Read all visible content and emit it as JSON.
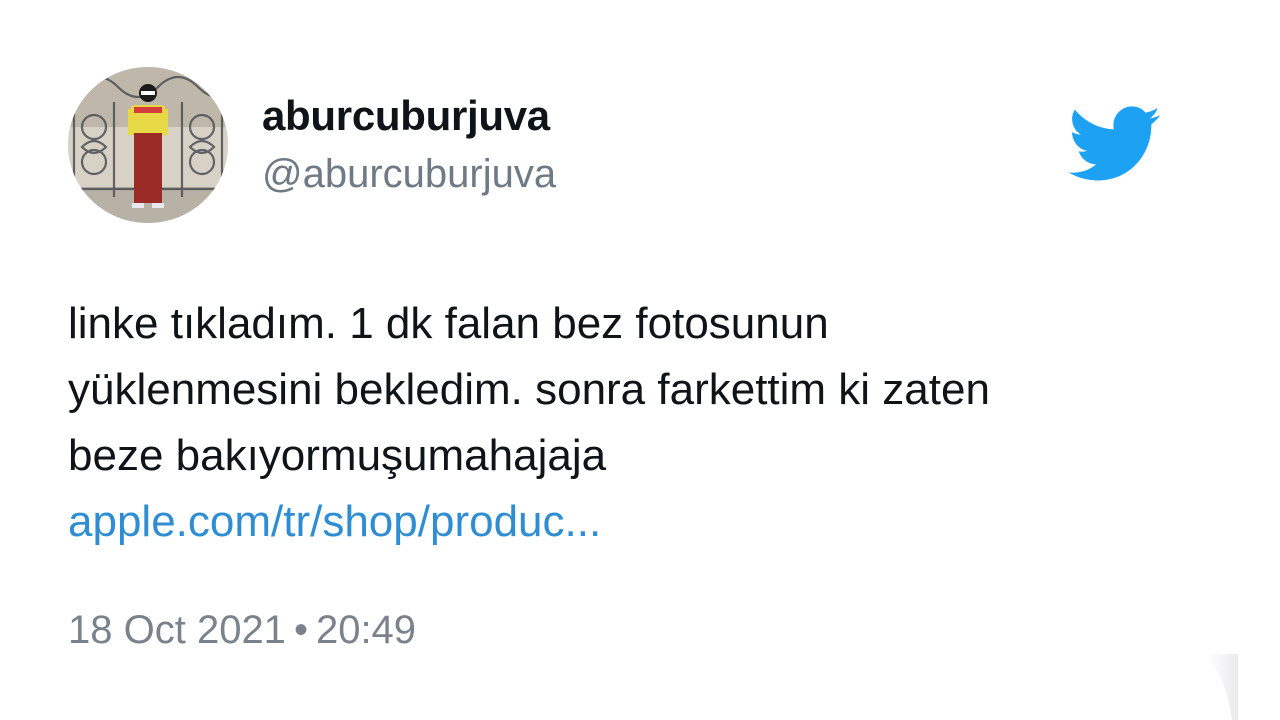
{
  "user": {
    "display_name": "aburcuburjuva",
    "handle": "@aburcuburjuva",
    "avatar_icon": "profile-photo"
  },
  "brand": {
    "icon": "twitter-bird-icon",
    "color": "#1da1f2"
  },
  "tweet": {
    "lines": [
      "linke tıkladım. 1 dk falan bez fotosunun",
      "yüklenmesini bekledim. sonra farkettim ki zaten",
      "beze bakıyormuşumahajaja"
    ],
    "link": "apple.com/tr/shop/produc..."
  },
  "meta": {
    "date": "18 Oct 2021",
    "separator": "•",
    "time": "20:49"
  },
  "colors": {
    "text": "#0f1419",
    "secondary": "#6e7a85",
    "link": "#2f8ed3"
  }
}
